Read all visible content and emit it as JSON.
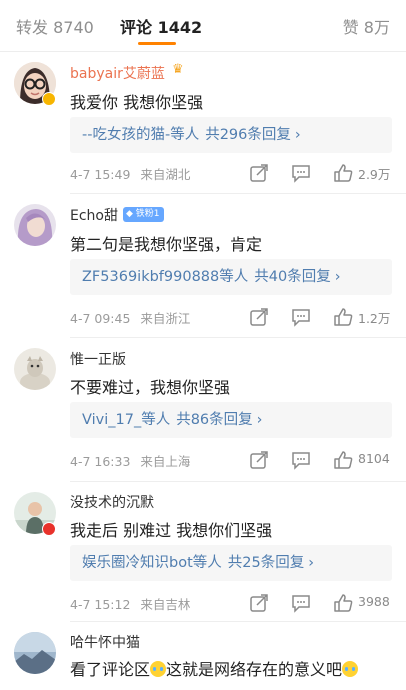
{
  "tabs": {
    "repost": "转发 8740",
    "comment": "评论 1442",
    "like": "赞 8万"
  },
  "comments": [
    {
      "username": "babyair艾蔚蓝",
      "text": "我爱你 我想你坚强",
      "reply_from": "--吃女孩的猫-等人",
      "reply_count": "共296条回复",
      "time": "4-7 15:49",
      "location": "来自湖北",
      "likes": "2.9万"
    },
    {
      "username": "Echo甜",
      "fan_badge": "铁粉1",
      "text": "第二句是我想你坚强，肯定",
      "reply_from": "ZF5369ikbf990888等人",
      "reply_count": "共40条回复",
      "time": "4-7 09:45",
      "location": "来自浙江",
      "likes": "1.2万"
    },
    {
      "username": "惟一正版",
      "text": "不要难过，我想你坚强",
      "reply_from": "Vivi_17_等人",
      "reply_count": "共86条回复",
      "time": "4-7 16:33",
      "location": "来自上海",
      "likes": "8104"
    },
    {
      "username": "没技术的沉默",
      "text": "我走后 别难过 我想你们坚强",
      "reply_from": "娱乐圈冷知识bot等人",
      "reply_count": "共25条回复",
      "time": "4-7 15:12",
      "location": "来自吉林",
      "likes": "3988"
    },
    {
      "username": "哈牛怀中猫",
      "text_before": "看了评论区",
      "text_middle": "这就是网络存在的意义吧",
      "emoji": "crying-emoji"
    }
  ],
  "colors": {
    "accent": "#ff8200",
    "link": "#507daf",
    "vip_name": "#eb7350"
  },
  "icons": [
    "share-icon",
    "comment-icon",
    "like-icon",
    "crown-icon",
    "verified-icon"
  ]
}
